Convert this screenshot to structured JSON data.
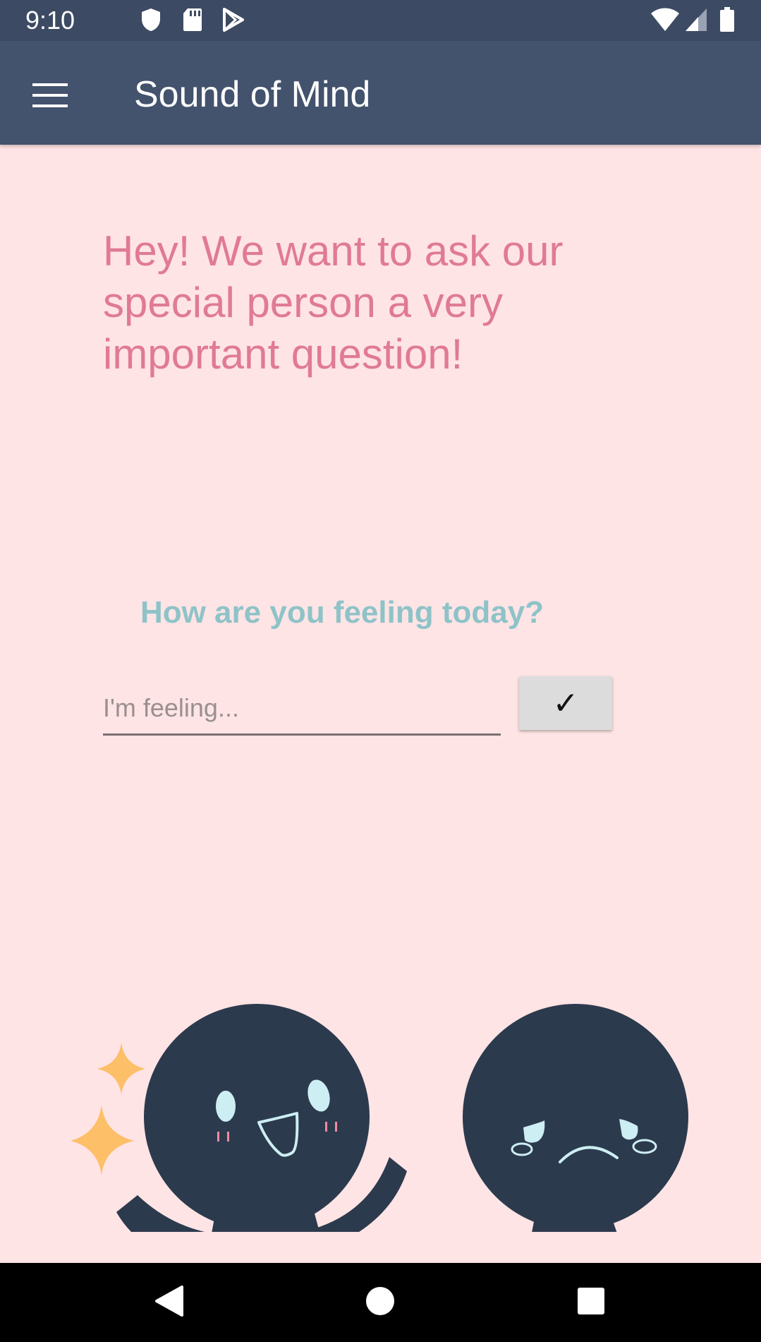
{
  "status_bar": {
    "time": "9:10",
    "left_icons": [
      "shield-icon",
      "sd-card-icon",
      "play-store-icon"
    ],
    "right_icons": [
      "wifi-icon",
      "signal-icon",
      "battery-icon"
    ]
  },
  "app_bar": {
    "menu_icon": "hamburger-menu-icon",
    "title": "Sound of Mind"
  },
  "main": {
    "intro": "Hey! We want to ask our special person a very important question!",
    "question": "How are you feeling today?",
    "feeling_input": {
      "value": "",
      "placeholder": "I'm feeling..."
    },
    "submit_label": "✓"
  },
  "nav_bar": {
    "buttons": [
      "back-icon",
      "home-icon",
      "recents-icon"
    ]
  },
  "colors": {
    "status_bar": "#3d4a63",
    "app_bar": "#43526d",
    "background": "#ffe4e5",
    "intro_text": "#e07a95",
    "question_text": "#8ec3c8",
    "figure": "#2c3a4d",
    "sparkle": "#fdbf67",
    "eyes": "#cdeef3",
    "blush": "#f08aa3"
  }
}
